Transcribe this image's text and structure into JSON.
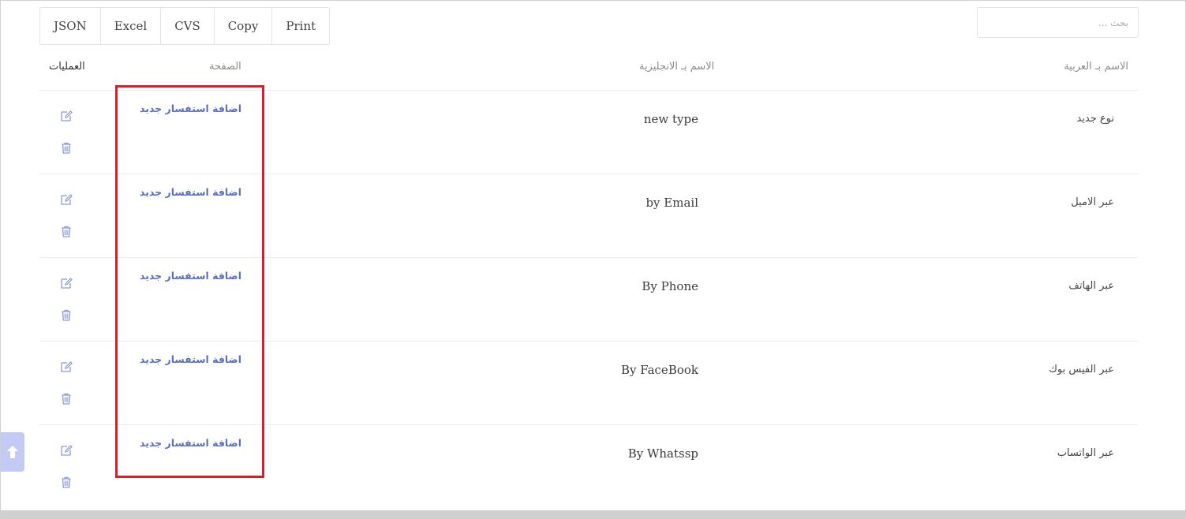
{
  "toolbar": {
    "buttons": [
      "JSON",
      "Excel",
      "CVS",
      "Copy",
      "Print"
    ]
  },
  "search": {
    "placeholder": "بحث ..."
  },
  "table": {
    "headers": {
      "operations": "العمليات",
      "page": "الصفحة",
      "name_en": "الاسم بـ الانجليزية",
      "name_ar": "الاسم بـ العربية"
    },
    "rows": [
      {
        "name_ar": "نوع جديد",
        "name_en": "new type",
        "page": "اضافة استفسار جديد"
      },
      {
        "name_ar": "عبر الاميل",
        "name_en": "by Email",
        "page": "اضافة استفسار جديد"
      },
      {
        "name_ar": "عبر الهاتف",
        "name_en": "By Phone",
        "page": "اضافة استفسار جديد"
      },
      {
        "name_ar": "عبر الفيس بوك",
        "name_en": "By FaceBook",
        "page": "اضافة استفسار جديد"
      },
      {
        "name_ar": "عبر الواتساب",
        "name_en": "By Whatssp",
        "page": "اضافة استفسار جديد"
      }
    ]
  },
  "icons": {
    "edit": "edit-icon",
    "trash": "trash-icon",
    "scroll_top": "arrow-up-icon"
  },
  "colors": {
    "link": "#5a6fc2",
    "icon": "#8a9ad9",
    "highlight": "#d81f26",
    "scroll_button": "#c3cbf5"
  }
}
